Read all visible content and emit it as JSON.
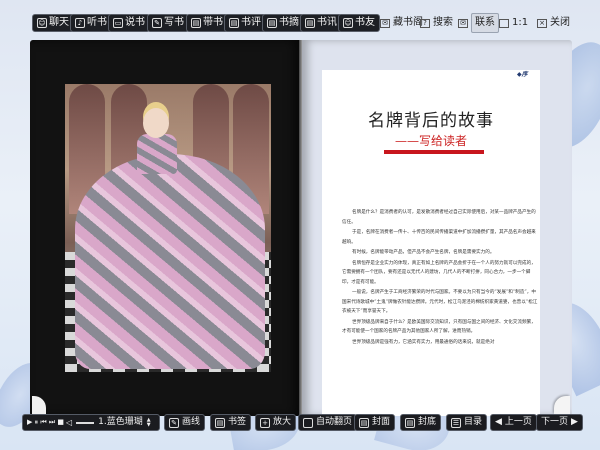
{
  "toolbar": {
    "chat": "聊天",
    "listen": "听书",
    "read": "说书",
    "write": "写书",
    "review": "带书",
    "comment": "书评",
    "bookmark": "书摘",
    "test": "书讯",
    "friends": "书友",
    "collection": "藏书阁",
    "search": "搜索",
    "contact": "联系",
    "ratio": "1:1",
    "close": "关闭"
  },
  "book": {
    "preface_tag": "序",
    "title": "名牌背后的故事",
    "subtitle": "——写给读者",
    "paragraphs": [
      "名牌是什么？是消费者的认可，是发散消费者经过自己实际使用后，对某一品牌产品产生的信任。",
      "于是，名牌在消费者一传十、十传百的民间传播渠道中扩加流播攒扩量，其产品名声会越来越响。",
      "有时候，名牌能带动产品，但产品不会产生名牌，名牌是需要实力的。",
      "名牌恒存是企业实力的体现，真正有如上名牌的产品会折于在一个人的努力就可以完成的，它需要拥有一个团队，要有还是以无代人的建坊，几代人的不断打拼，同心合力，一步一个脚印，才是有可能。",
      "一般说，名牌产生于工商经济繁荣的时代与国家。不要以为只有当今的“发展”和“制造”，中国宋代诗歌城中“土鬼”牌做农针能达攒牌。元代时，松江乌泥泾的棉纺织家黄道婆，也曾以“松江衣被天下”而享誉天下。",
      "世界顶级品牌来自于什么？是欧美国际交流知识，只有国与国之间的经济、文化交流频繁，才有可能使一个国家的名牌产品为其他国家人所了解，进而热销。",
      "世界顶级品牌是强有力，它涵实有实力，用最通俗的话来说，就是绝对"
    ]
  },
  "bottombar": {
    "player_controls": "▶ ⏸ ⏮ ⏭ ■",
    "track": "1.蓝色珊瑚",
    "draw": "画线",
    "bookmark": "书签",
    "zoom": "放大",
    "auto_flip": "自动翻页",
    "cover": "封面",
    "back_cover": "封底",
    "catalog": "目录",
    "prev": "上一页",
    "next": "下一页"
  }
}
